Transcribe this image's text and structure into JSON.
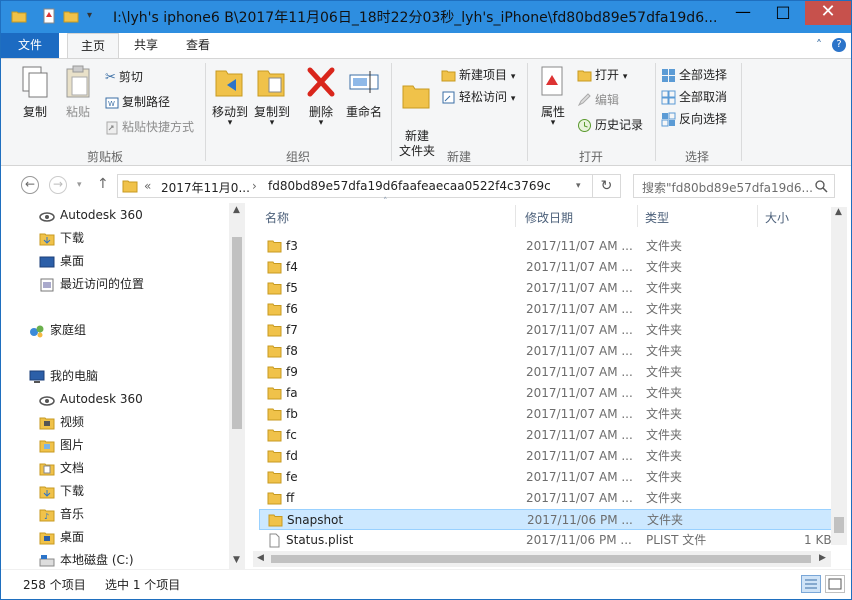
{
  "window": {
    "title": "I:\\lyh's iphone6 B\\2017年11月06日_18时22分03秒_lyh's_iPhone\\fd80bd89e57dfa19d6...",
    "minimize": "—",
    "maximize": "□",
    "close": "✕"
  },
  "ribbon_tabs": {
    "file": "文件",
    "home": "主页",
    "share": "共享",
    "view": "查看"
  },
  "ribbon": {
    "clipboard": {
      "label": "剪贴板",
      "copy": "复制",
      "paste": "粘贴",
      "cut": "剪切",
      "copy_path": "复制路径",
      "paste_shortcut": "粘贴快捷方式"
    },
    "organize": {
      "label": "组织",
      "move_to": "移动到",
      "copy_to": "复制到",
      "delete": "删除",
      "rename": "重命名"
    },
    "new": {
      "label": "新建",
      "new_folder": "新建\n文件夹",
      "new_item": "新建项目",
      "easy_access": "轻松访问"
    },
    "open": {
      "label": "打开",
      "properties": "属性",
      "open": "打开",
      "edit": "编辑",
      "history": "历史记录"
    },
    "select": {
      "label": "选择",
      "select_all": "全部选择",
      "select_none": "全部取消",
      "invert": "反向选择"
    }
  },
  "address": {
    "crumb_prefix": "«",
    "crumb1": "2017年11月0...",
    "crumb_sep": "›",
    "crumb2": "fd80bd89e57dfa19d6faafeaecaa0522f4c3769c",
    "search_placeholder": "搜索\"fd80bd89e57dfa19d6..."
  },
  "nav_pane": {
    "items": [
      {
        "label": "Autodesk 360"
      },
      {
        "label": "下载"
      },
      {
        "label": "桌面"
      },
      {
        "label": "最近访问的位置"
      },
      {
        "label": "家庭组"
      },
      {
        "label": "我的电脑"
      },
      {
        "label": "Autodesk 360"
      },
      {
        "label": "视频"
      },
      {
        "label": "图片"
      },
      {
        "label": "文档"
      },
      {
        "label": "下载"
      },
      {
        "label": "音乐"
      },
      {
        "label": "桌面"
      },
      {
        "label": "本地磁盘 (C:)"
      }
    ]
  },
  "columns": {
    "name": "名称",
    "date": "修改日期",
    "type": "类型",
    "size": "大小"
  },
  "files": [
    {
      "name": "f3",
      "date": "2017/11/07 AM ...",
      "type": "文件夹",
      "size": ""
    },
    {
      "name": "f4",
      "date": "2017/11/07 AM ...",
      "type": "文件夹",
      "size": ""
    },
    {
      "name": "f5",
      "date": "2017/11/07 AM ...",
      "type": "文件夹",
      "size": ""
    },
    {
      "name": "f6",
      "date": "2017/11/07 AM ...",
      "type": "文件夹",
      "size": ""
    },
    {
      "name": "f7",
      "date": "2017/11/07 AM ...",
      "type": "文件夹",
      "size": ""
    },
    {
      "name": "f8",
      "date": "2017/11/07 AM ...",
      "type": "文件夹",
      "size": ""
    },
    {
      "name": "f9",
      "date": "2017/11/07 AM ...",
      "type": "文件夹",
      "size": ""
    },
    {
      "name": "fa",
      "date": "2017/11/07 AM ...",
      "type": "文件夹",
      "size": ""
    },
    {
      "name": "fb",
      "date": "2017/11/07 AM ...",
      "type": "文件夹",
      "size": ""
    },
    {
      "name": "fc",
      "date": "2017/11/07 AM ...",
      "type": "文件夹",
      "size": ""
    },
    {
      "name": "fd",
      "date": "2017/11/07 AM ...",
      "type": "文件夹",
      "size": ""
    },
    {
      "name": "fe",
      "date": "2017/11/07 AM ...",
      "type": "文件夹",
      "size": ""
    },
    {
      "name": "ff",
      "date": "2017/11/07 AM ...",
      "type": "文件夹",
      "size": ""
    },
    {
      "name": "Snapshot",
      "date": "2017/11/06 PM ...",
      "type": "文件夹",
      "size": ""
    },
    {
      "name": "Status.plist",
      "date": "2017/11/06 PM ...",
      "type": "PLIST 文件",
      "size": "1 KB"
    }
  ],
  "status": {
    "count": "258 个项目",
    "selection": "选中 1 个项目"
  },
  "colors": {
    "titlebar": "#2e8ee0",
    "file_tab": "#1c6bc2",
    "selection": "#cce8ff",
    "folder": "#f0c24a"
  }
}
